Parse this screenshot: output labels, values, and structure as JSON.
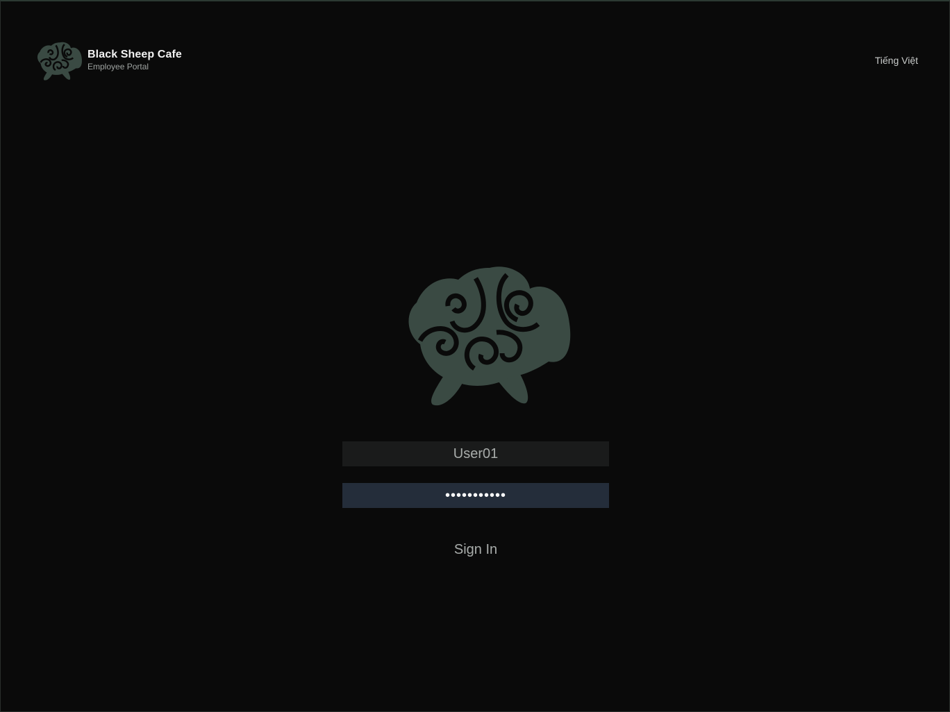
{
  "header": {
    "app_title": "Black Sheep Cafe",
    "app_subtitle": "Employee Portal",
    "language_label": "Tiếng Việt"
  },
  "login": {
    "username_value": "User01",
    "password_value": "•••••••••••",
    "sign_in_label": "Sign In"
  },
  "colors": {
    "background": "#0a0a0a",
    "logo": "#3a4a43",
    "username_field": "#1a1b1b",
    "password_field": "#242d3a"
  },
  "icons": {
    "brand_logo": "sheep-logo-icon",
    "hero_logo": "sheep-logo-icon"
  }
}
